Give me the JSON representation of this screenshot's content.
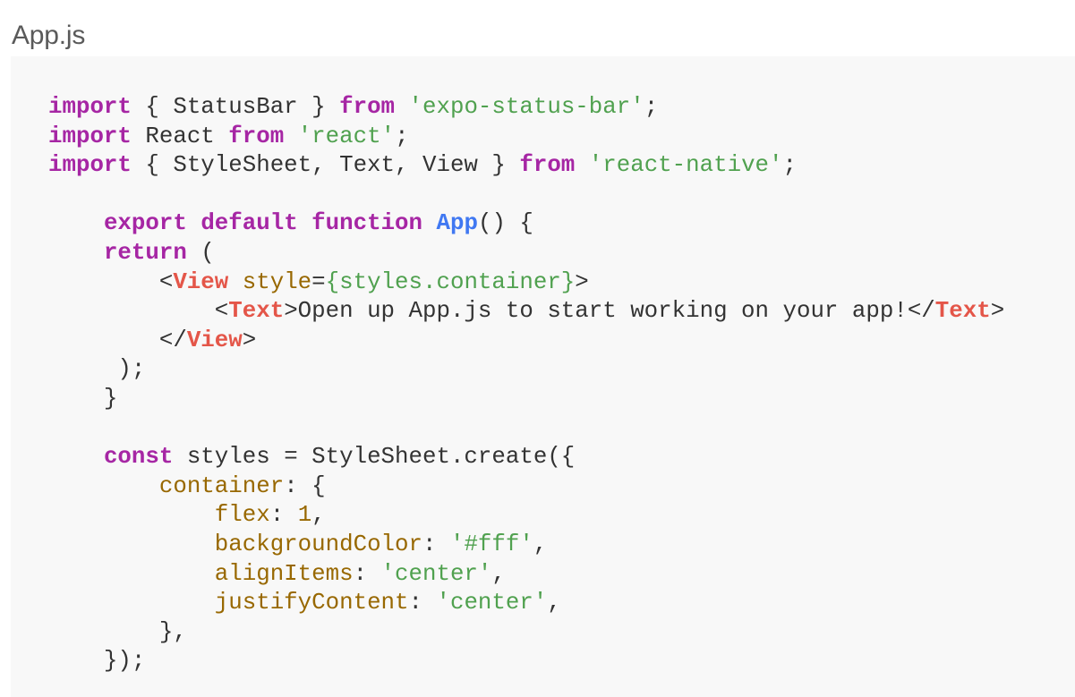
{
  "file": {
    "title": "App.js"
  },
  "code": {
    "lines": [
      [
        {
          "t": "import",
          "c": "kw"
        },
        {
          "t": " { StatusBar } ",
          "c": "plain"
        },
        {
          "t": "from",
          "c": "kw"
        },
        {
          "t": " ",
          "c": "plain"
        },
        {
          "t": "'expo-status-bar'",
          "c": "str"
        },
        {
          "t": ";",
          "c": "plain"
        }
      ],
      [
        {
          "t": "import",
          "c": "kw"
        },
        {
          "t": " React ",
          "c": "plain"
        },
        {
          "t": "from",
          "c": "kw"
        },
        {
          "t": " ",
          "c": "plain"
        },
        {
          "t": "'react'",
          "c": "str"
        },
        {
          "t": ";",
          "c": "plain"
        }
      ],
      [
        {
          "t": "import",
          "c": "kw"
        },
        {
          "t": " { StyleSheet, Text, View } ",
          "c": "plain"
        },
        {
          "t": "from",
          "c": "kw"
        },
        {
          "t": " ",
          "c": "plain"
        },
        {
          "t": "'react-native'",
          "c": "str"
        },
        {
          "t": ";",
          "c": "plain"
        }
      ],
      [],
      [
        {
          "t": "    ",
          "c": "plain"
        },
        {
          "t": "export",
          "c": "kw"
        },
        {
          "t": " ",
          "c": "plain"
        },
        {
          "t": "default",
          "c": "kw"
        },
        {
          "t": " ",
          "c": "plain"
        },
        {
          "t": "function",
          "c": "kw"
        },
        {
          "t": " ",
          "c": "plain"
        },
        {
          "t": "App",
          "c": "fn"
        },
        {
          "t": "() {",
          "c": "plain"
        }
      ],
      [
        {
          "t": "    ",
          "c": "plain"
        },
        {
          "t": "return",
          "c": "kw"
        },
        {
          "t": " (",
          "c": "plain"
        }
      ],
      [
        {
          "t": "        <",
          "c": "plain"
        },
        {
          "t": "View",
          "c": "tag"
        },
        {
          "t": " ",
          "c": "plain"
        },
        {
          "t": "style",
          "c": "attr"
        },
        {
          "t": "=",
          "c": "plain"
        },
        {
          "t": "{styles.container}",
          "c": "str"
        },
        {
          "t": ">",
          "c": "plain"
        }
      ],
      [
        {
          "t": "            <",
          "c": "plain"
        },
        {
          "t": "Text",
          "c": "tag"
        },
        {
          "t": ">Open up App.js to start working on your app!</",
          "c": "plain"
        },
        {
          "t": "Text",
          "c": "tag"
        },
        {
          "t": ">",
          "c": "plain"
        }
      ],
      [
        {
          "t": "        </",
          "c": "plain"
        },
        {
          "t": "View",
          "c": "tag"
        },
        {
          "t": ">",
          "c": "plain"
        }
      ],
      [
        {
          "t": "     );",
          "c": "plain"
        }
      ],
      [
        {
          "t": "    }",
          "c": "plain"
        }
      ],
      [],
      [
        {
          "t": "    ",
          "c": "plain"
        },
        {
          "t": "const",
          "c": "kw"
        },
        {
          "t": " styles = StyleSheet.create({",
          "c": "plain"
        }
      ],
      [
        {
          "t": "        ",
          "c": "plain"
        },
        {
          "t": "container",
          "c": "prop"
        },
        {
          "t": ": {",
          "c": "plain"
        }
      ],
      [
        {
          "t": "            ",
          "c": "plain"
        },
        {
          "t": "flex",
          "c": "prop"
        },
        {
          "t": ": ",
          "c": "plain"
        },
        {
          "t": "1",
          "c": "num"
        },
        {
          "t": ",",
          "c": "plain"
        }
      ],
      [
        {
          "t": "            ",
          "c": "plain"
        },
        {
          "t": "backgroundColor",
          "c": "prop"
        },
        {
          "t": ": ",
          "c": "plain"
        },
        {
          "t": "'#fff'",
          "c": "str"
        },
        {
          "t": ",",
          "c": "plain"
        }
      ],
      [
        {
          "t": "            ",
          "c": "plain"
        },
        {
          "t": "alignItems",
          "c": "prop"
        },
        {
          "t": ": ",
          "c": "plain"
        },
        {
          "t": "'center'",
          "c": "str"
        },
        {
          "t": ",",
          "c": "plain"
        }
      ],
      [
        {
          "t": "            ",
          "c": "plain"
        },
        {
          "t": "justifyContent",
          "c": "prop"
        },
        {
          "t": ": ",
          "c": "plain"
        },
        {
          "t": "'center'",
          "c": "str"
        },
        {
          "t": ",",
          "c": "plain"
        }
      ],
      [
        {
          "t": "        },",
          "c": "plain"
        }
      ],
      [
        {
          "t": "    });",
          "c": "plain"
        }
      ]
    ]
  },
  "colors": {
    "keyword": "#a626a4",
    "string": "#50a14f",
    "function": "#4078f2",
    "tag": "#e45649",
    "property": "#986801",
    "text": "#333333",
    "code_background": "#f8f8f8"
  }
}
